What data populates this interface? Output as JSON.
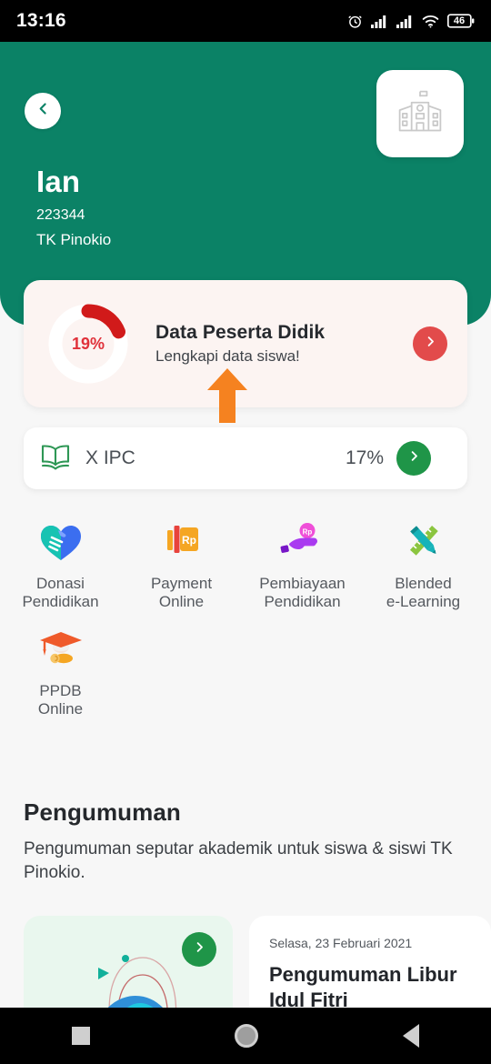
{
  "status_bar": {
    "time": "13:16",
    "battery_level": "46",
    "icons": [
      "alarm-icon",
      "signal-1-icon",
      "signal-2-icon",
      "wifi-icon",
      "battery-icon"
    ]
  },
  "header": {
    "back_icon": "chevron-left-icon",
    "school_icon": "school-building-icon",
    "student_name": "Ian",
    "student_id": "223344",
    "school_name": "TK Pinokio",
    "background_color": "#0b8266"
  },
  "data_card": {
    "percent_label": "19%",
    "percent_value": 19,
    "title": "Data Peserta Didik",
    "subtitle": "Lengkapi data siswa!",
    "arrow_icon": "chevron-right-icon",
    "accent_color": "#e0313a",
    "button_color": "#e24b4b",
    "background_color": "#fcf4f2"
  },
  "annotation": {
    "arrow_icon": "arrow-up-icon",
    "color": "#f58220"
  },
  "class_card": {
    "icon": "open-book-icon",
    "name": "X IPC",
    "percent": "17%",
    "arrow_icon": "chevron-right-icon",
    "button_color": "#1f9548"
  },
  "menu": {
    "items": [
      {
        "icon": "handshake-heart-icon",
        "label": "Donasi\nPendidikan",
        "line1": "Donasi",
        "line2": "Pendidikan"
      },
      {
        "icon": "rupiah-card-icon",
        "label": "Payment\nOnline",
        "line1": "Payment",
        "line2": "Online"
      },
      {
        "icon": "hand-coin-icon",
        "label": "Pembiayaan\nPendidikan",
        "line1": "Pembiayaan",
        "line2": "Pendidikan"
      },
      {
        "icon": "pencil-ruler-icon",
        "label": "Blended\ne-Learning",
        "line1": "Blended",
        "line2": "e-Learning"
      },
      {
        "icon": "graduation-cap-icon",
        "label": "PPDB\nOnline",
        "line1": "PPDB",
        "line2": "Online"
      }
    ]
  },
  "announcements": {
    "section_title": "Pengumuman",
    "section_description": "Pengumuman seputar akademik untuk siswa & siswi TK Pinokio.",
    "cards": [
      {
        "type": "illustration",
        "arrow_icon": "chevron-right-icon",
        "background_color": "#e9f7ee"
      },
      {
        "type": "text",
        "date": "Selasa, 23 Februari 2021",
        "headline": "Pengumuman Libur Idul Fitri"
      }
    ]
  },
  "nav_bar": {
    "recents_icon": "square-icon",
    "home_icon": "circle-icon",
    "back_icon": "triangle-back-icon"
  }
}
